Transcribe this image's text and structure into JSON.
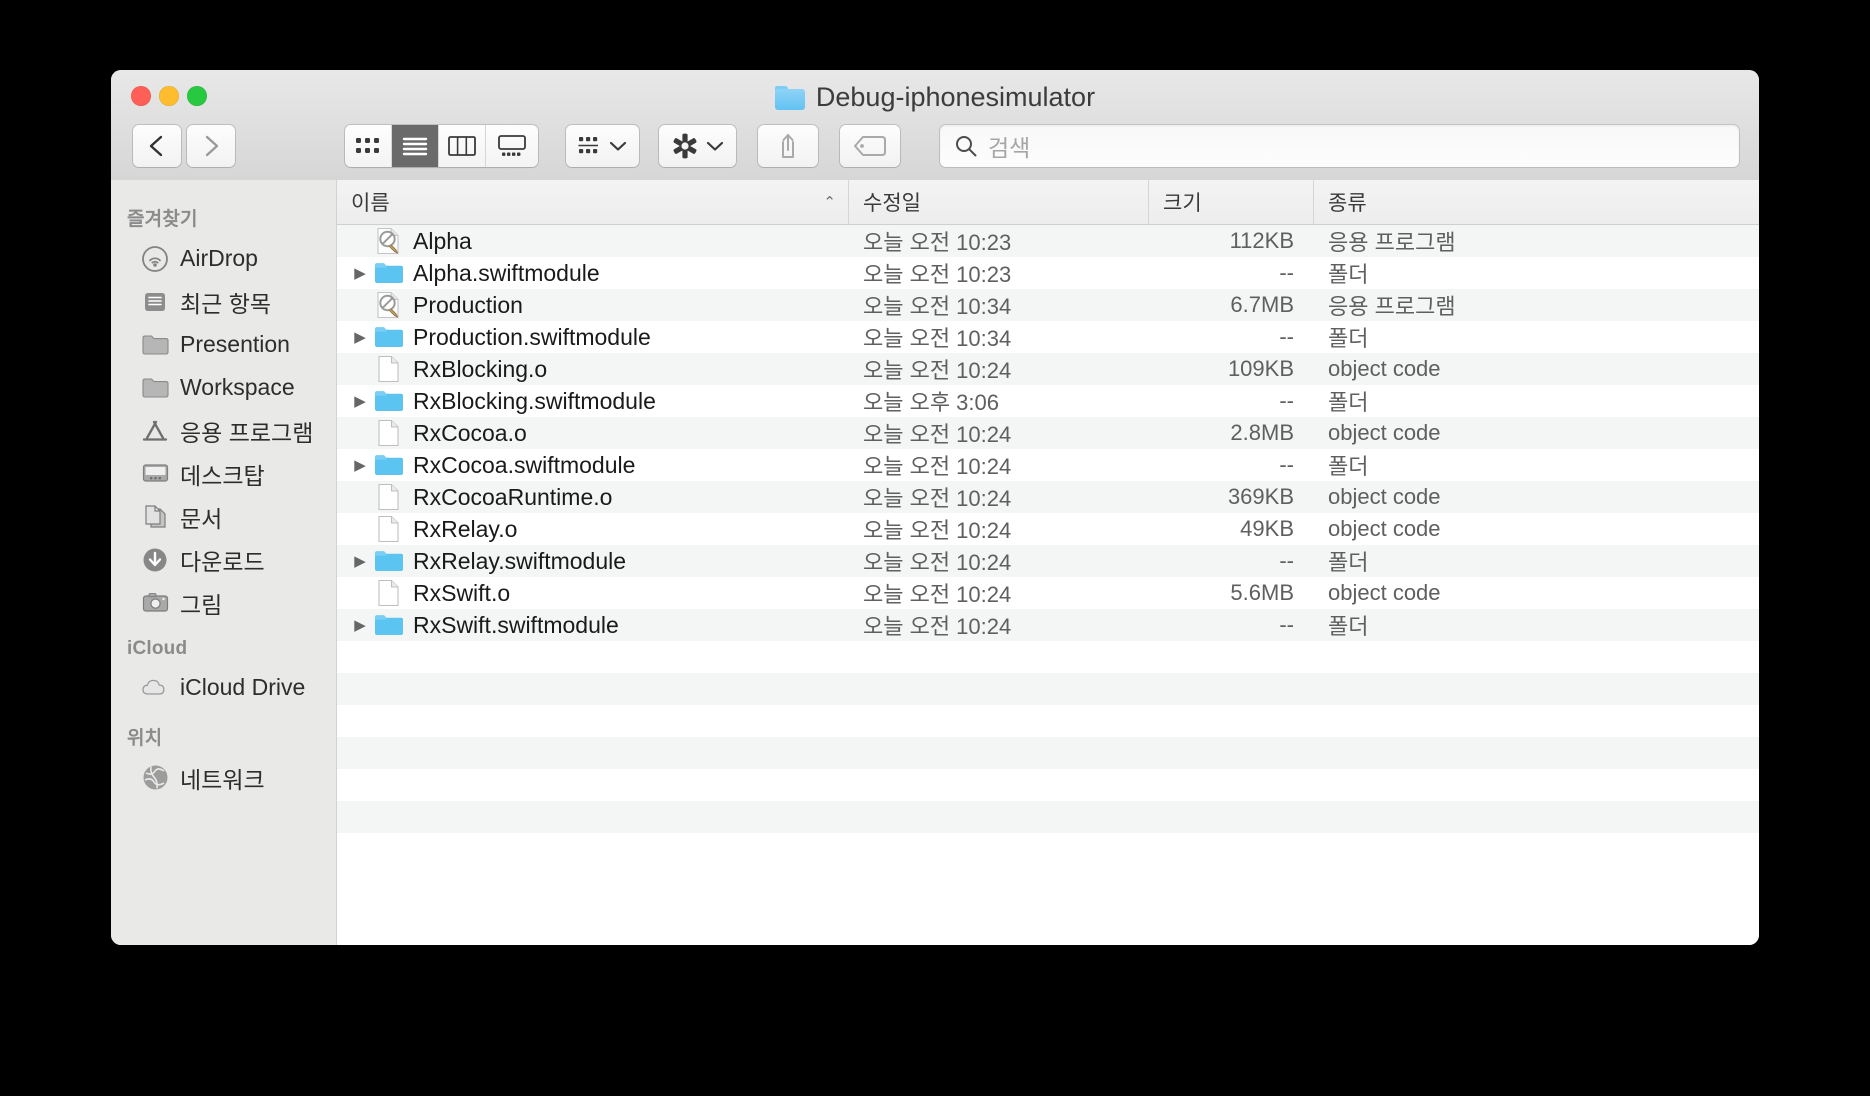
{
  "window": {
    "title": "Debug-iphonesimulator",
    "title_icon": "folder-icon",
    "traffic_lights": {
      "close": "close-window-button",
      "minimize": "minimize-window-button",
      "maximize": "maximize-window-button"
    }
  },
  "toolbar": {
    "back_icon": "chevron-left-icon",
    "forward_icon": "chevron-right-icon",
    "view_icon_grid": "icon-view-button",
    "view_list": "list-view-button",
    "view_columns": "column-view-button",
    "view_gallery": "gallery-view-button",
    "group_icon": "group-by-button",
    "group_chevron": "chevron-down-icon",
    "action_icon": "gear-icon",
    "action_chevron": "chevron-down-icon",
    "share_icon": "share-icon",
    "tag_icon": "tag-icon",
    "active_view": "list"
  },
  "search": {
    "placeholder": "검색",
    "value": "",
    "icon": "search-icon"
  },
  "sidebar": {
    "sections": [
      {
        "title": "즐겨찾기",
        "items": [
          {
            "label": "AirDrop",
            "icon": "airdrop-icon"
          },
          {
            "label": "최근 항목",
            "icon": "recents-icon"
          },
          {
            "label": "Presention",
            "icon": "folder-icon"
          },
          {
            "label": "Workspace",
            "icon": "folder-icon"
          },
          {
            "label": "응용 프로그램",
            "icon": "applications-icon"
          },
          {
            "label": "데스크탑",
            "icon": "desktop-icon"
          },
          {
            "label": "문서",
            "icon": "documents-icon"
          },
          {
            "label": "다운로드",
            "icon": "downloads-icon"
          },
          {
            "label": "그림",
            "icon": "pictures-icon"
          }
        ]
      },
      {
        "title": "iCloud",
        "items": [
          {
            "label": "iCloud Drive",
            "icon": "icloud-icon"
          }
        ]
      },
      {
        "title": "위치",
        "items": [
          {
            "label": "네트워크",
            "icon": "network-icon"
          }
        ]
      }
    ]
  },
  "filelist": {
    "columns": [
      {
        "key": "name",
        "label": "이름",
        "sorted": true,
        "sort_direction": "ascending",
        "sort_glyph": "⌃"
      },
      {
        "key": "date",
        "label": "수정일"
      },
      {
        "key": "size",
        "label": "크기"
      },
      {
        "key": "kind",
        "label": "종류"
      }
    ],
    "rows": [
      {
        "name": "Alpha",
        "icon": "unix-executable-icon",
        "expandable": false,
        "date": "오늘 오전 10:23",
        "size": "112KB",
        "kind": "응용 프로그램"
      },
      {
        "name": "Alpha.swiftmodule",
        "icon": "folder-icon",
        "expandable": true,
        "date": "오늘 오전 10:23",
        "size": "--",
        "kind": "폴더"
      },
      {
        "name": "Production",
        "icon": "unix-executable-icon",
        "expandable": false,
        "date": "오늘 오전 10:34",
        "size": "6.7MB",
        "kind": "응용 프로그램"
      },
      {
        "name": "Production.swiftmodule",
        "icon": "folder-icon",
        "expandable": true,
        "date": "오늘 오전 10:34",
        "size": "--",
        "kind": "폴더"
      },
      {
        "name": "RxBlocking.o",
        "icon": "document-icon",
        "expandable": false,
        "date": "오늘 오전 10:24",
        "size": "109KB",
        "kind": "object code"
      },
      {
        "name": "RxBlocking.swiftmodule",
        "icon": "folder-icon",
        "expandable": true,
        "date": "오늘 오후 3:06",
        "size": "--",
        "kind": "폴더"
      },
      {
        "name": "RxCocoa.o",
        "icon": "document-icon",
        "expandable": false,
        "date": "오늘 오전 10:24",
        "size": "2.8MB",
        "kind": "object code"
      },
      {
        "name": "RxCocoa.swiftmodule",
        "icon": "folder-icon",
        "expandable": true,
        "date": "오늘 오전 10:24",
        "size": "--",
        "kind": "폴더"
      },
      {
        "name": "RxCocoaRuntime.o",
        "icon": "document-icon",
        "expandable": false,
        "date": "오늘 오전 10:24",
        "size": "369KB",
        "kind": "object code"
      },
      {
        "name": "RxRelay.o",
        "icon": "document-icon",
        "expandable": false,
        "date": "오늘 오전 10:24",
        "size": "49KB",
        "kind": "object code"
      },
      {
        "name": "RxRelay.swiftmodule",
        "icon": "folder-icon",
        "expandable": true,
        "date": "오늘 오전 10:24",
        "size": "--",
        "kind": "폴더"
      },
      {
        "name": "RxSwift.o",
        "icon": "document-icon",
        "expandable": false,
        "date": "오늘 오전 10:24",
        "size": "5.6MB",
        "kind": "object code"
      },
      {
        "name": "RxSwift.swiftmodule",
        "icon": "folder-icon",
        "expandable": true,
        "date": "오늘 오전 10:24",
        "size": "--",
        "kind": "폴더"
      }
    ],
    "empty_row_count": 6
  },
  "colors": {
    "folder_blue": "#5bc4f1",
    "window_chrome": "#e8e8e8",
    "sidebar_bg": "#e9e9e7",
    "row_stripe": "#f4f5f5",
    "desktop_bg": "#000000"
  }
}
